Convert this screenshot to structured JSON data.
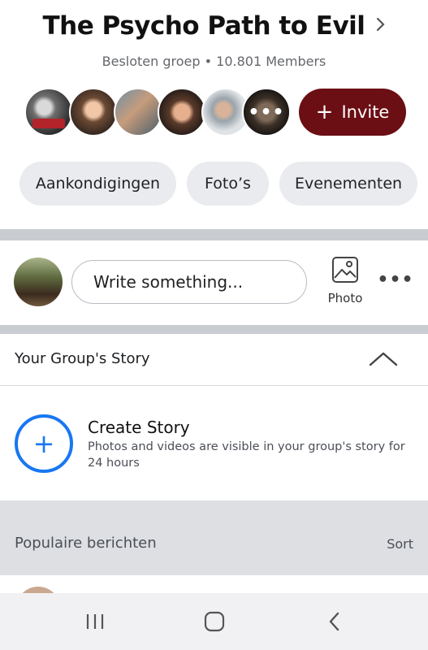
{
  "group": {
    "title": "The Psycho Path to Evil",
    "subtitle": "Besloten groep • 10.801 Members",
    "more_members": "•••",
    "invite_label": "Invite"
  },
  "tabs": [
    {
      "label": "Aankondigingen"
    },
    {
      "label": "Foto’s"
    },
    {
      "label": "Evenementen"
    }
  ],
  "composer": {
    "placeholder": "Write something...",
    "photo_label": "Photo"
  },
  "story": {
    "section_title": "Your Group's Story",
    "create_title": "Create Story",
    "create_desc": "Photos and videos are visible in your group's story for 24 hours"
  },
  "popular": {
    "title": "Populaire berichten",
    "sort_label": "Sort"
  },
  "colors": {
    "invite_bg": "#6b0f14",
    "accent_blue": "#1877f2",
    "chip_bg": "#e9ebee"
  },
  "icons": [
    "chevron-right-icon",
    "plus-icon",
    "photo-icon",
    "more-icon",
    "chevron-up-icon",
    "recents-icon",
    "home-icon",
    "back-icon"
  ]
}
